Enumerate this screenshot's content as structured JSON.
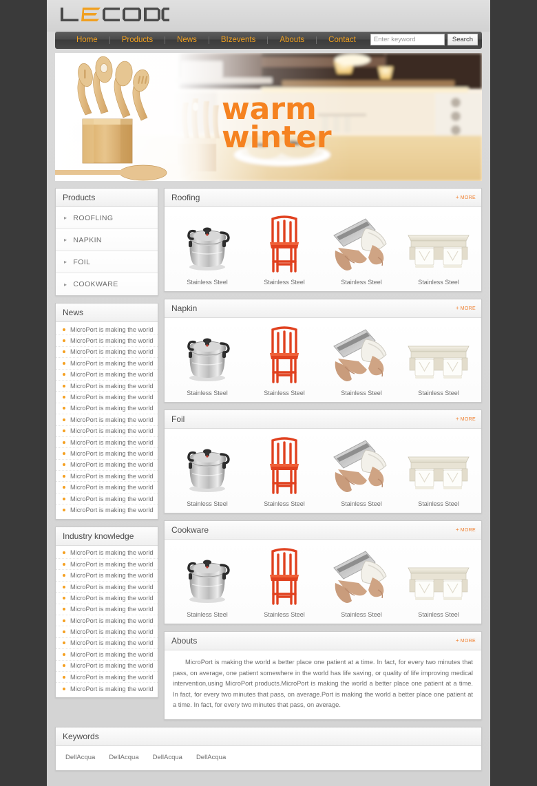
{
  "site": {
    "logo_text": "LECODO",
    "logo_accent_letter": "E",
    "accent_color": "#f0a020",
    "orange_link_color": "#f08030"
  },
  "nav": {
    "items": [
      {
        "label": "Home"
      },
      {
        "label": "Products"
      },
      {
        "label": "News"
      },
      {
        "label": "BIzevents"
      },
      {
        "label": "Abouts"
      },
      {
        "label": "Contact"
      }
    ],
    "search": {
      "placeholder": "Enter keyword",
      "value": "",
      "button_label": "Search"
    }
  },
  "banner": {
    "headline_line1": "warm",
    "headline_line2": "winter",
    "headline_color": "#f58220",
    "scene": "kitchen-with-wooden-utensils"
  },
  "sidebar": {
    "products": {
      "title": "Products",
      "items": [
        {
          "label": "ROOFLING"
        },
        {
          "label": "NAPKIN"
        },
        {
          "label": "FOIL"
        },
        {
          "label": "COOKWARE"
        }
      ]
    },
    "news": {
      "title": "News",
      "item_text": "MicroPort is making the world",
      "count": 17
    },
    "industry": {
      "title": "Industry knowledge",
      "item_text": "MicroPort is making the world",
      "count": 13
    }
  },
  "main": {
    "more_label": "MORE",
    "more_plus": "+",
    "product_caption": "Stainless Steel",
    "sections": [
      {
        "title": "Roofing",
        "products": [
          "pressure-cooker",
          "red-chair",
          "foil-dispenser",
          "paper-holder"
        ]
      },
      {
        "title": "Napkin",
        "products": [
          "pressure-cooker",
          "red-chair",
          "foil-dispenser",
          "paper-holder"
        ]
      },
      {
        "title": "Foil",
        "products": [
          "pressure-cooker",
          "red-chair",
          "foil-dispenser",
          "paper-holder"
        ]
      },
      {
        "title": "Cookware",
        "products": [
          "pressure-cooker",
          "red-chair",
          "foil-dispenser",
          "paper-holder"
        ]
      }
    ],
    "abouts": {
      "title": "Abouts",
      "text": "MicroPort is making the world a better place one patient at a time. In fact, for every two minutes that pass,   on average, one patient somewhere in the world has life saving, or quality of life improving medical intervention,using MicroPort products.MicroPort is making the world a better place one patient at a time. In fact, for every  two minutes that pass, on average.Port is making the world a better place one patient at a time. In fact, for every  two minutes that pass, on average."
    }
  },
  "keywords": {
    "title": "Keywords",
    "items": [
      "DellAcqua",
      "DellAcqua",
      "DellAcqua",
      "DellAcqua"
    ]
  }
}
